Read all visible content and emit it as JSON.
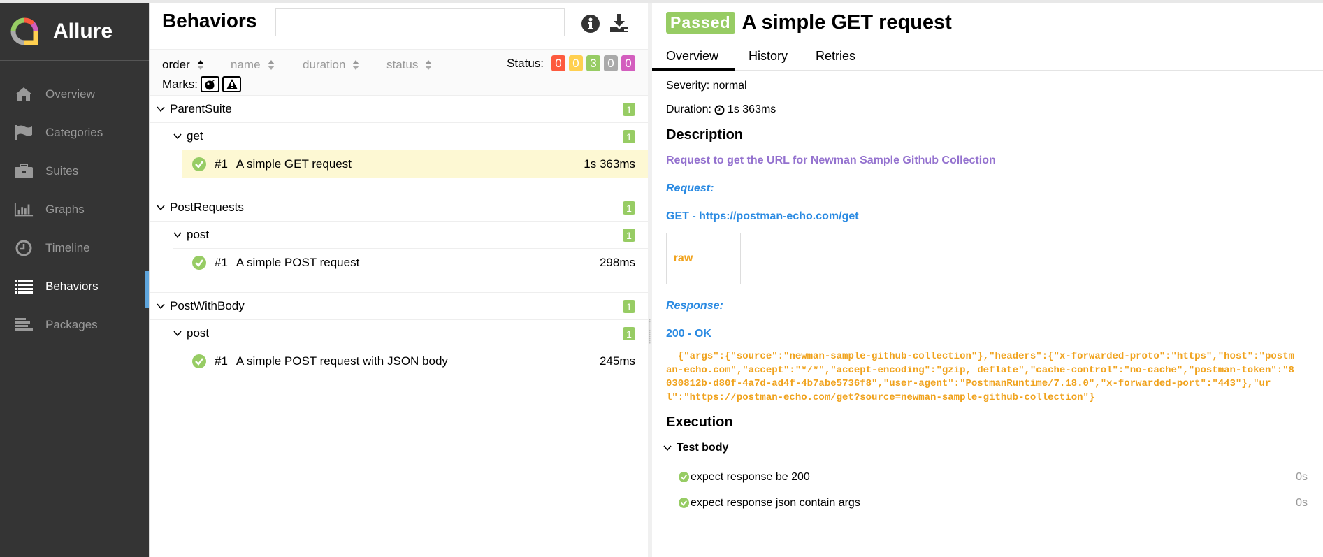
{
  "app": {
    "name": "Allure"
  },
  "sidebar": {
    "items": [
      {
        "label": "Overview",
        "icon": "home-icon",
        "active": false
      },
      {
        "label": "Categories",
        "icon": "flag-icon",
        "active": false
      },
      {
        "label": "Suites",
        "icon": "briefcase-icon",
        "active": false
      },
      {
        "label": "Graphs",
        "icon": "bar-chart-icon",
        "active": false
      },
      {
        "label": "Timeline",
        "icon": "clock-icon",
        "active": false
      },
      {
        "label": "Behaviors",
        "icon": "list-icon",
        "active": true
      },
      {
        "label": "Packages",
        "icon": "align-left-icon",
        "active": false
      }
    ]
  },
  "behaviors": {
    "title": "Behaviors",
    "search": {
      "value": "",
      "placeholder": ""
    },
    "sorters": [
      {
        "label": "order",
        "active": true
      },
      {
        "label": "name",
        "active": false
      },
      {
        "label": "duration",
        "active": false
      },
      {
        "label": "status",
        "active": false
      }
    ],
    "status_label": "Status:",
    "status_counts": [
      {
        "status": "failed",
        "count": "0",
        "color": "#fd5a3e"
      },
      {
        "status": "broken",
        "count": "0",
        "color": "#ffd050"
      },
      {
        "status": "passed",
        "count": "3",
        "color": "#97cc64"
      },
      {
        "status": "skipped",
        "count": "0",
        "color": "#aaaaaa"
      },
      {
        "status": "unknown",
        "count": "0",
        "color": "#d35ebe"
      }
    ],
    "marks_label": "Marks:",
    "groups": [
      {
        "name": "ParentSuite",
        "count": "1",
        "subgroup": {
          "name": "get",
          "count": "1"
        },
        "test": {
          "num": "#1",
          "name": "A simple GET request",
          "duration": "1s 363ms",
          "selected": true
        }
      },
      {
        "name": "PostRequests",
        "count": "1",
        "subgroup": {
          "name": "post",
          "count": "1"
        },
        "test": {
          "num": "#1",
          "name": "A simple POST request",
          "duration": "298ms",
          "selected": false
        }
      },
      {
        "name": "PostWithBody",
        "count": "1",
        "subgroup": {
          "name": "post",
          "count": "1"
        },
        "test": {
          "num": "#1",
          "name": "A simple POST request with JSON body",
          "duration": "245ms",
          "selected": false
        }
      }
    ]
  },
  "detail": {
    "status": "Passed",
    "status_color": "#97cc64",
    "title": "A simple GET request",
    "tabs": [
      "Overview",
      "History",
      "Retries"
    ],
    "active_tab": "Overview",
    "severity": "Severity: normal",
    "duration_label": "Duration:",
    "duration": "1s 363ms",
    "description_heading": "Description",
    "description": "Request to get the URL for Newman Sample Github Collection",
    "request_label": "Request:",
    "request_line": "GET - https://postman-echo.com/get",
    "raw_label": "raw",
    "response_label": "Response:",
    "response_status": "200 - OK",
    "response_body": "  {\"args\":{\"source\":\"newman-sample-github-collection\"},\"headers\":{\"x-forwarded-proto\":\"https\",\"host\":\"postman-echo.com\",\"accept\":\"*/*\",\"accept-encoding\":\"gzip, deflate\",\"cache-control\":\"no-cache\",\"postman-token\":\"8030812b-d80f-4a7d-ad4f-4b7abe5736f8\",\"user-agent\":\"PostmanRuntime/7.18.0\",\"x-forwarded-port\":\"443\"},\"url\":\"https://postman-echo.com/get?source=newman-sample-github-collection\"}",
    "execution_heading": "Execution",
    "test_body_label": "Test body",
    "steps": [
      {
        "name": "expect response be 200",
        "duration": "0s"
      },
      {
        "name": "expect response json contain args",
        "duration": "0s"
      }
    ]
  }
}
